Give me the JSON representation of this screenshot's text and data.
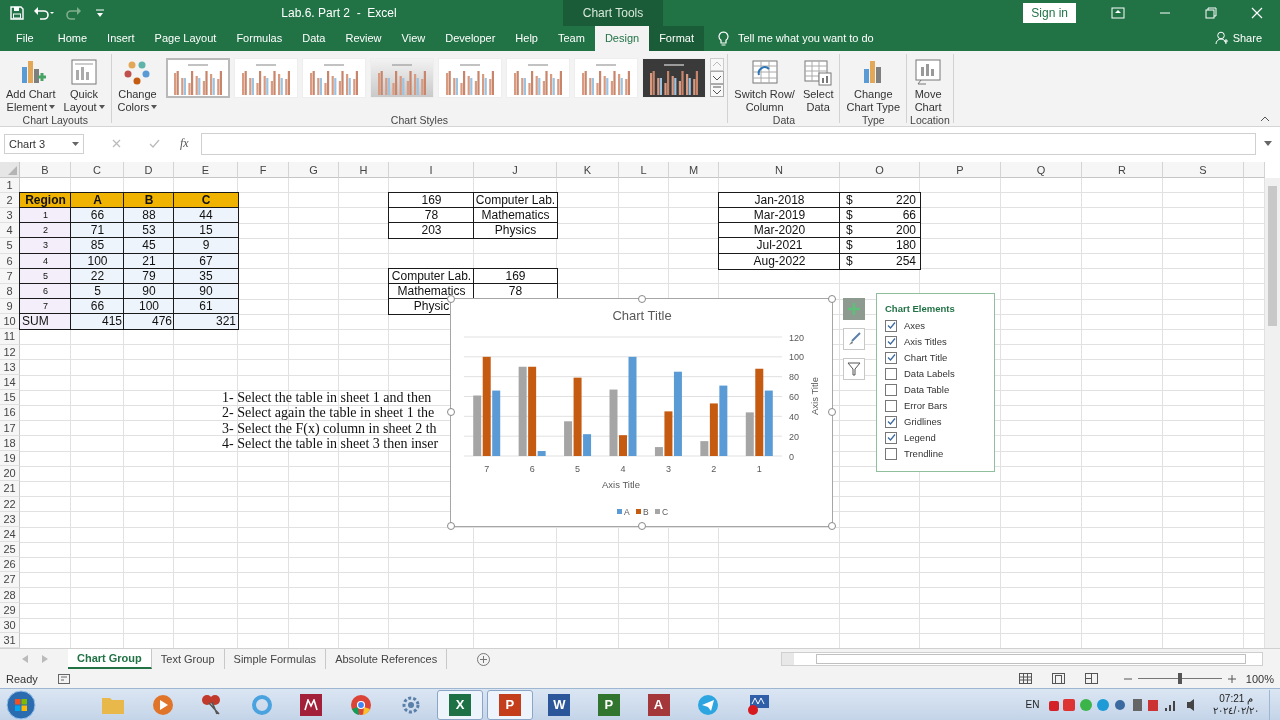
{
  "window": {
    "title": "Lab.6. Part 2  -  Excel",
    "context_tab": "Chart Tools",
    "sign_in": "Sign in"
  },
  "ribbon_tabs": [
    {
      "label": "File",
      "selected": false,
      "contextual": false
    },
    {
      "label": "Home",
      "selected": false,
      "contextual": false
    },
    {
      "label": "Insert",
      "selected": false,
      "contextual": false
    },
    {
      "label": "Page Layout",
      "selected": false,
      "contextual": false
    },
    {
      "label": "Formulas",
      "selected": false,
      "contextual": false
    },
    {
      "label": "Data",
      "selected": false,
      "contextual": false
    },
    {
      "label": "Review",
      "selected": false,
      "contextual": false
    },
    {
      "label": "View",
      "selected": false,
      "contextual": false
    },
    {
      "label": "Developer",
      "selected": false,
      "contextual": false
    },
    {
      "label": "Help",
      "selected": false,
      "contextual": false
    },
    {
      "label": "Team",
      "selected": false,
      "contextual": false
    },
    {
      "label": "Design",
      "selected": true,
      "contextual": true
    },
    {
      "label": "Format",
      "selected": false,
      "contextual": true
    }
  ],
  "tell_me": "Tell me what you want to do",
  "share": "Share",
  "ribbon_groups": [
    {
      "label": "Chart Layouts",
      "buttons": [
        {
          "kind": "add-element",
          "lines": [
            "Add Chart",
            "Element"
          ],
          "dropdown": true
        },
        {
          "kind": "quick-layout",
          "lines": [
            "Quick",
            "Layout"
          ],
          "dropdown": true
        }
      ]
    },
    {
      "label": "Chart Styles",
      "buttons": [
        {
          "kind": "colors",
          "lines": [
            "Change",
            "Colors"
          ],
          "dropdown": true
        }
      ],
      "styles": [
        {
          "kind": "plain",
          "selected": true
        },
        {
          "kind": "plain",
          "selected": false
        },
        {
          "kind": "plain",
          "selected": false
        },
        {
          "kind": "shaded",
          "selected": false
        },
        {
          "kind": "plain",
          "selected": false
        },
        {
          "kind": "plain",
          "selected": false
        },
        {
          "kind": "plain",
          "selected": false
        },
        {
          "kind": "dark",
          "selected": false
        }
      ]
    },
    {
      "label": "Data",
      "buttons": [
        {
          "kind": "switch",
          "lines": [
            "Switch Row/",
            "Column"
          ],
          "dropdown": false
        },
        {
          "kind": "select-data",
          "lines": [
            "Select",
            "Data"
          ],
          "dropdown": false
        }
      ]
    },
    {
      "label": "Type",
      "buttons": [
        {
          "kind": "change-type",
          "lines": [
            "Change",
            "Chart Type"
          ],
          "dropdown": false
        }
      ]
    },
    {
      "label": "Location",
      "buttons": [
        {
          "kind": "move",
          "lines": [
            "Move",
            "Chart"
          ],
          "dropdown": false
        }
      ]
    }
  ],
  "formula_bar": {
    "name_box": "Chart 3",
    "function_label": "fx"
  },
  "columns": [
    "B",
    "C",
    "D",
    "E",
    "F",
    "G",
    "H",
    "I",
    "J",
    "K",
    "L",
    "M",
    "N",
    "O",
    "P",
    "Q",
    "R",
    "S"
  ],
  "row_numbers": [
    "1",
    "2",
    "3",
    "4",
    "5",
    "6",
    "7",
    "8",
    "9",
    "10",
    "11",
    "12",
    "13",
    "14",
    "15",
    "16",
    "17",
    "18",
    "19",
    "20",
    "21",
    "22",
    "23",
    "24",
    "25",
    "26",
    "27",
    "28",
    "29",
    "30",
    "31"
  ],
  "region_table": {
    "header": [
      "Region",
      "A",
      "B",
      "C"
    ],
    "rows": [
      [
        "1",
        "66",
        "88",
        "44"
      ],
      [
        "2",
        "71",
        "53",
        "15"
      ],
      [
        "3",
        "85",
        "45",
        "9"
      ],
      [
        "4",
        "100",
        "21",
        "67"
      ],
      [
        "5",
        "22",
        "79",
        "35"
      ],
      [
        "6",
        "5",
        "90",
        "90"
      ],
      [
        "7",
        "66",
        "100",
        "61"
      ]
    ],
    "total": [
      "SUM",
      "415",
      "476",
      "321"
    ]
  },
  "lab_table": [
    [
      "169",
      "Computer Lab."
    ],
    [
      "78",
      "Mathematics"
    ],
    [
      "203",
      "Physics"
    ]
  ],
  "lab_table_2": [
    [
      "Computer Lab.",
      "169"
    ],
    [
      "Mathematics",
      "78"
    ],
    [
      "Physic"
    ]
  ],
  "date_table": [
    [
      "Jan-2018",
      "$",
      "220"
    ],
    [
      "Mar-2019",
      "$",
      "66"
    ],
    [
      "Mar-2020",
      "$",
      "200"
    ],
    [
      "Jul-2021",
      "$",
      "180"
    ],
    [
      "Aug-2022",
      "$",
      "254"
    ]
  ],
  "instructions": [
    "1- Select the table in sheet 1 and then",
    "2- Select again the table in sheet 1 the",
    "3- Select the F(x) column in sheet 2 th",
    "4- Select the table in sheet 3 then inser"
  ],
  "chart": {
    "chart_data": {
      "type": "bar",
      "title": "Chart Title",
      "xlabel": "Axis Title",
      "ylabel": "Axis Title",
      "categories": [
        "7",
        "6",
        "5",
        "4",
        "3",
        "2",
        "1"
      ],
      "series": [
        {
          "name": "A",
          "color": "#5b9bd5",
          "values": [
            66,
            5,
            22,
            100,
            85,
            71,
            66
          ]
        },
        {
          "name": "B",
          "color": "#c55a11",
          "values": [
            100,
            90,
            79,
            21,
            45,
            53,
            88
          ]
        },
        {
          "name": "C",
          "color": "#a5a5a5",
          "values": [
            61,
            90,
            35,
            67,
            9,
            15,
            44
          ]
        }
      ],
      "ylim": [
        0,
        120
      ],
      "yticks": [
        0,
        20,
        40,
        60,
        80,
        100,
        120
      ],
      "grid": true,
      "legend": "bottom"
    }
  },
  "chart_elements": {
    "title": "Chart Elements",
    "items": [
      {
        "label": "Axes",
        "checked": true
      },
      {
        "label": "Axis Titles",
        "checked": true
      },
      {
        "label": "Chart Title",
        "checked": true
      },
      {
        "label": "Data Labels",
        "checked": false
      },
      {
        "label": "Data Table",
        "checked": false
      },
      {
        "label": "Error Bars",
        "checked": false
      },
      {
        "label": "Gridlines",
        "checked": true
      },
      {
        "label": "Legend",
        "checked": true
      },
      {
        "label": "Trendline",
        "checked": false
      }
    ]
  },
  "sheet_tabs": [
    {
      "label": "Chart Group",
      "selected": true
    },
    {
      "label": "Text Group",
      "selected": false
    },
    {
      "label": "Simple Formulas",
      "selected": false
    },
    {
      "label": "Absolute References",
      "selected": false
    }
  ],
  "status_bar": {
    "status": "Ready",
    "zoom": {
      "level": 0.5,
      "reading": "100%"
    }
  },
  "taskbar": {
    "apps": [
      {
        "kind": "folder",
        "color": "#e8b84a",
        "active": false
      },
      {
        "kind": "media",
        "color": "#e0752a",
        "active": false
      },
      {
        "kind": "scissors",
        "color": "#c0392b",
        "active": false
      },
      {
        "kind": "ring",
        "color": "#4aa3df",
        "active": false
      },
      {
        "kind": "tile",
        "color": "#a3203a",
        "active": false
      },
      {
        "kind": "browser",
        "color": "#db4437",
        "active": false
      },
      {
        "kind": "gear",
        "color": "#5a7fa8",
        "active": false
      },
      {
        "kind": "tile",
        "color": "#1e7145",
        "active": true,
        "letter": "X"
      },
      {
        "kind": "tile",
        "color": "#c43e1c",
        "active": true,
        "letter": "P"
      },
      {
        "kind": "tile",
        "color": "#2b579a",
        "active": false,
        "letter": "W"
      },
      {
        "kind": "tile",
        "color": "#31752f",
        "active": false,
        "letter": "P"
      },
      {
        "kind": "tile",
        "color": "#a4373a",
        "active": false,
        "letter": "A"
      },
      {
        "kind": "plane",
        "color": "#2ca5e0",
        "active": false
      },
      {
        "kind": "meter",
        "color": "#2f5fa8",
        "active": false
      }
    ],
    "language": "EN",
    "time": "07:21 م",
    "date": "٢٠٢٤/٠٢/٢٠"
  }
}
